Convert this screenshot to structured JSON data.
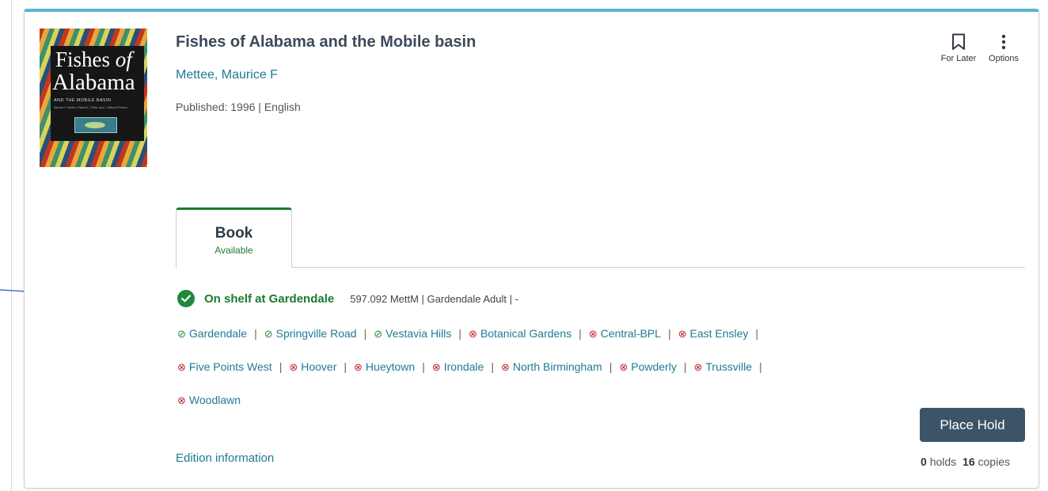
{
  "record": {
    "title": "Fishes of Alabama and the Mobile basin",
    "author": "Mettee, Maurice F",
    "published": "Published: 1996 | English",
    "cover": {
      "line1": "Fishes",
      "line1_italic": "of",
      "line2": "Alabama",
      "line3": "AND THE MOBILE BASIN",
      "line4": "Maurice F. Mettee, Patrick E. O'Neil, and J. Malcolm Pierson"
    }
  },
  "actions": {
    "for_later_label": "For Later",
    "options_label": "Options"
  },
  "format_tab": {
    "label": "Book",
    "status": "Available"
  },
  "availability": {
    "status_text": "On shelf at Gardendale",
    "call_info": "597.092 MettM | Gardendale Adult | -"
  },
  "locations": [
    {
      "name": "Gardendale",
      "available": true
    },
    {
      "name": "Springville Road",
      "available": true
    },
    {
      "name": "Vestavia Hills",
      "available": true
    },
    {
      "name": "Botanical Gardens",
      "available": false
    },
    {
      "name": "Central-BPL",
      "available": false
    },
    {
      "name": "East Ensley",
      "available": false
    },
    {
      "name": "Five Points West",
      "available": false
    },
    {
      "name": "Hoover",
      "available": false
    },
    {
      "name": "Hueytown",
      "available": false
    },
    {
      "name": "Irondale",
      "available": false
    },
    {
      "name": "North Birmingham",
      "available": false
    },
    {
      "name": "Powderly",
      "available": false
    },
    {
      "name": "Trussville",
      "available": false
    },
    {
      "name": "Woodlawn",
      "available": false
    }
  ],
  "place_hold_label": "Place Hold",
  "edition_link": "Edition information",
  "holds": {
    "holds_count": "0",
    "holds_label": "holds",
    "copies_count": "16",
    "copies_label": "copies"
  },
  "colors": {
    "accent_top": "#5bb4d2",
    "link": "#1f7a94",
    "available_green": "#1e8a3a",
    "unavailable_red": "#c0262c",
    "button": "#3c5468",
    "annotation_arrow": "#4472c4"
  },
  "icons": {
    "for_later": "bookmark-icon",
    "options": "vertical-dots-icon",
    "status": "check-circle-icon",
    "available": "check-circle-outline-icon",
    "unavailable": "x-circle-icon"
  }
}
